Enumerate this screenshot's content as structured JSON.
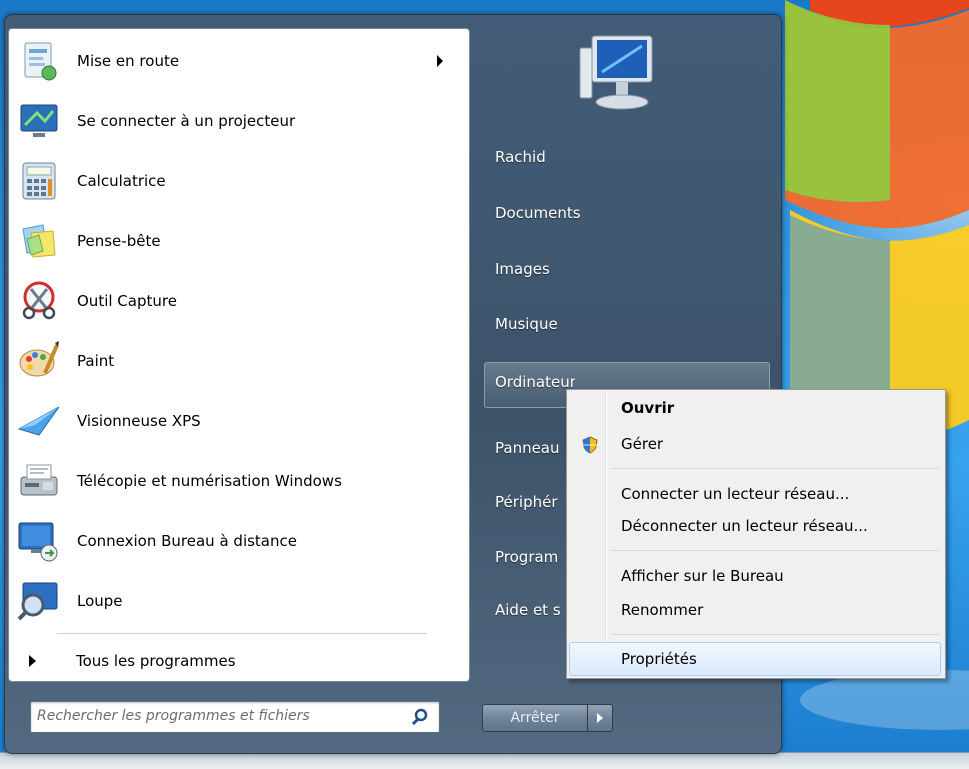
{
  "left_pane": {
    "programs": [
      {
        "label": "Mise en route",
        "icon": "getting-started-icon",
        "has_submenu": true
      },
      {
        "label": "Se connecter à un projecteur",
        "icon": "projector-icon"
      },
      {
        "label": "Calculatrice",
        "icon": "calculator-icon"
      },
      {
        "label": "Pense-bête",
        "icon": "sticky-notes-icon"
      },
      {
        "label": "Outil Capture",
        "icon": "snipping-tool-icon"
      },
      {
        "label": "Paint",
        "icon": "paint-icon"
      },
      {
        "label": "Visionneuse XPS",
        "icon": "xps-viewer-icon"
      },
      {
        "label": "Télécopie et numérisation Windows",
        "icon": "fax-scan-icon"
      },
      {
        "label": "Connexion Bureau à distance",
        "icon": "remote-desktop-icon"
      },
      {
        "label": "Loupe",
        "icon": "magnifier-icon"
      }
    ],
    "all_programs_label": "Tous les programmes",
    "search_placeholder": "Rechercher les programmes et fichiers"
  },
  "right_pane": {
    "links": [
      "Rachid",
      "Documents",
      "Images",
      "Musique",
      "Ordinateur",
      "Panneau",
      "Périphér",
      "Program",
      "Aide et s"
    ],
    "shutdown_label": "Arrêter"
  },
  "context_menu": {
    "items": [
      "Ouvrir",
      "Gérer",
      "Connecter un lecteur réseau...",
      "Déconnecter un lecteur réseau...",
      "Afficher sur le Bureau",
      "Renommer",
      "Propriétés"
    ],
    "default_item": "Ouvrir",
    "highlighted_item": "Propriétés"
  },
  "colors": {
    "menu_frame": "#3c4e62",
    "context_highlight": "#dbeafc",
    "desktop_blue": "#2f97e3"
  }
}
